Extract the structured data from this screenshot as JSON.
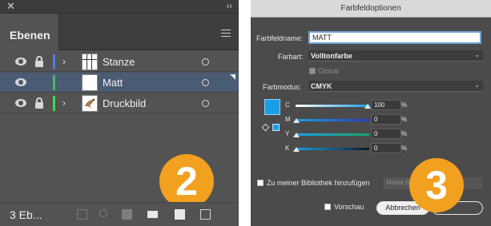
{
  "layers_panel": {
    "tab_label": "Ebenen",
    "layers": [
      {
        "name": "Stanze",
        "color": "#4a7de8",
        "locked": true,
        "selected": false
      },
      {
        "name": "Matt",
        "color": "#3fc05a",
        "locked": false,
        "selected": true
      },
      {
        "name": "Druckbild",
        "color": "#3fd94a",
        "locked": true,
        "selected": false
      }
    ],
    "footer_count": "3 Eb...",
    "badge": "2"
  },
  "swatch_dialog": {
    "title": "Farbfeldoptionen",
    "name_label": "Farbfeldname:",
    "name_value": "MATT",
    "type_label": "Farbart:",
    "type_value": "Volltonfarbe",
    "global_label": "Global",
    "mode_label": "Farbmodus:",
    "mode_value": "CMYK",
    "sliders": [
      {
        "label": "C",
        "value": "100",
        "unit": "%"
      },
      {
        "label": "M",
        "value": "0",
        "unit": "%"
      },
      {
        "label": "Y",
        "value": "0",
        "unit": "%"
      },
      {
        "label": "K",
        "value": "0",
        "unit": "%"
      }
    ],
    "add_to_library_label": "Zu meiner Bibliothek hinzufügen",
    "library_select": "Meine Bi",
    "preview_label": "Vorschau",
    "cancel_label": "Abbrechen",
    "badge": "3",
    "swatch_color": "#1a9fe6"
  }
}
